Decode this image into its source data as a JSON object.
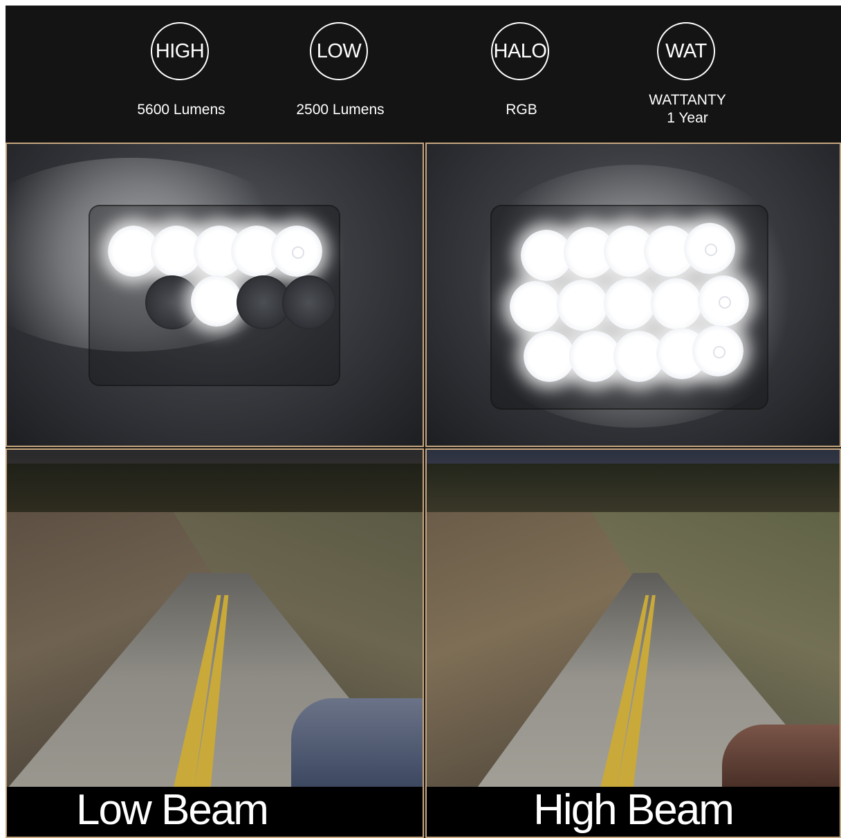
{
  "features": [
    {
      "badge": "HIGH",
      "label_lines": [
        "5600 Lumens"
      ]
    },
    {
      "badge": "LOW",
      "label_lines": [
        "2500 Lumens"
      ]
    },
    {
      "badge": "HALO",
      "label_lines": [
        "RGB"
      ]
    },
    {
      "badge": "WAT",
      "label_lines": [
        "WATTANTY",
        "1 Year"
      ]
    }
  ],
  "panels": {
    "low_beam_caption": "Low Beam",
    "high_beam_caption": "High Beam"
  },
  "colors": {
    "header_bg": "#141414",
    "divider": "#c7a780",
    "text": "#ffffff"
  }
}
